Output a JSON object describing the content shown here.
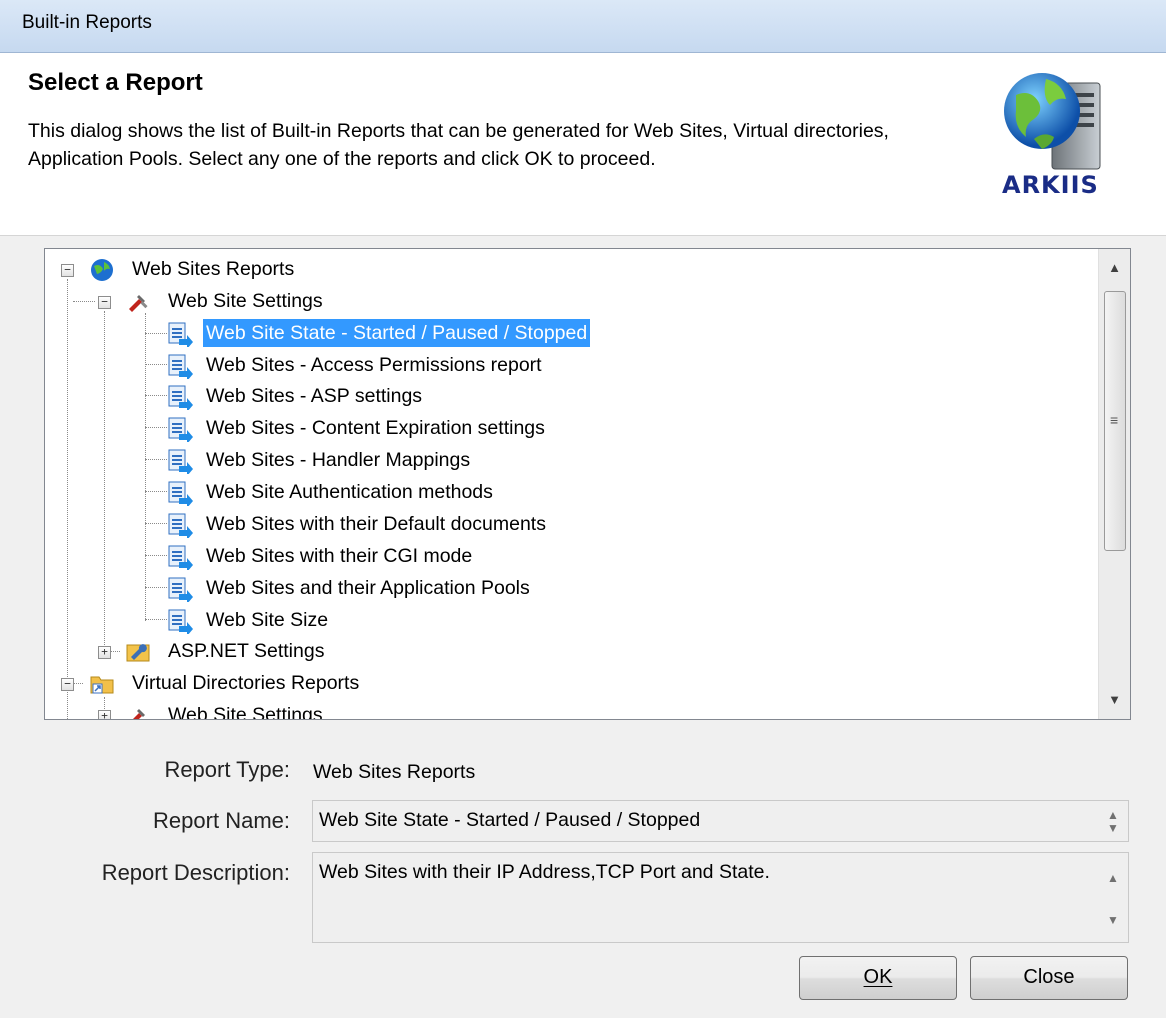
{
  "window": {
    "title": "Built-in Reports"
  },
  "header": {
    "heading": "Select a Report",
    "description": "This dialog shows the list of Built-in Reports that can be generated for Web Sites, Virtual directories, Application Pools. Select any one of the reports and click OK to proceed.",
    "logo_text": "ARKIIS"
  },
  "tree": {
    "web_sites_reports": "Web Sites Reports",
    "web_site_settings": "Web Site Settings",
    "items": [
      "Web Site State - Started / Paused / Stopped",
      "Web Sites - Access Permissions report",
      "Web Sites - ASP settings",
      "Web Sites - Content Expiration settings",
      "Web Sites - Handler Mappings",
      "Web Site Authentication methods",
      "Web Sites with their Default documents",
      "Web Sites with their CGI mode",
      "Web Sites and their Application Pools",
      "Web Site Size"
    ],
    "selected_item": "Web Site State - Started / Paused / Stopped",
    "aspnet_settings": "ASP.NET Settings",
    "virtual_directories_reports": "Virtual Directories Reports",
    "vdir_web_site_settings": "Web Site Settings",
    "expand_sign": "+",
    "collapse_sign": "−"
  },
  "scrollbar": {
    "up": "▲",
    "down": "▼",
    "grip": "≡"
  },
  "details": {
    "type_label": "Report Type:",
    "type_value": "Web Sites Reports",
    "name_label": "Report Name:",
    "name_value": "Web Site State - Started / Paused / Stopped",
    "description_label": "Report Description:",
    "description_value": "Web Sites with their IP Address,TCP Port and State."
  },
  "buttons": {
    "ok": "OK",
    "close": "Close"
  },
  "colors": {
    "selection": "#3399ff",
    "title_bar": "#c6d9f0",
    "logo_text": "#1a2c86"
  }
}
